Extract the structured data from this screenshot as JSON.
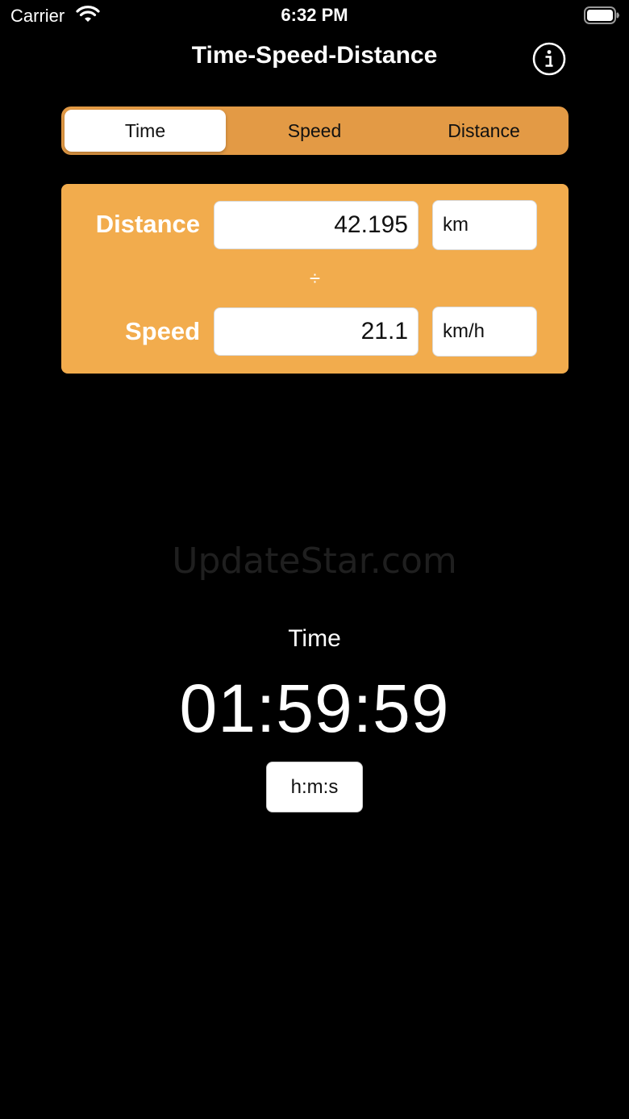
{
  "status_bar": {
    "carrier": "Carrier",
    "time": "6:32 PM"
  },
  "nav": {
    "title": "Time-Speed-Distance",
    "info_icon": "info-circle-icon"
  },
  "segments": {
    "items": [
      {
        "label": "Time",
        "selected": true
      },
      {
        "label": "Speed",
        "selected": false
      },
      {
        "label": "Distance",
        "selected": false
      }
    ]
  },
  "inputs": {
    "distance": {
      "label": "Distance",
      "value": "42.195",
      "unit": "km"
    },
    "operator": "÷",
    "speed": {
      "label": "Speed",
      "value": "21.1",
      "unit": "km/h"
    }
  },
  "watermark": "UpdateStar.com",
  "result": {
    "label": "Time",
    "value": "01:59:59",
    "format": "h:m:s"
  },
  "colors": {
    "background": "#000000",
    "segment_bg": "#e39a45",
    "card_bg": "#f2ac4d",
    "text_light": "#ffffff"
  }
}
